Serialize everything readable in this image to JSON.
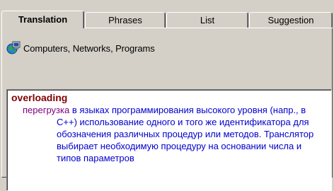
{
  "tabs": [
    {
      "label": "Translation",
      "active": true
    },
    {
      "label": "Phrases",
      "active": false
    },
    {
      "label": "List",
      "active": false
    },
    {
      "label": "Suggestion",
      "active": false
    }
  ],
  "category": {
    "icon": "globe-computer-icon",
    "label": "Computers, Networks, Programs"
  },
  "article": {
    "headword": "overloading",
    "translation": "перегрузка",
    "definition": "в языках программирования высокого уровня (напр., в С++) использование одного и того же идентификатора для обозначения различных процедур или методов. Транслятор выбирает необходимую процедуру на основании числа и типов параметров"
  },
  "colors": {
    "headword": "#800000",
    "translation": "#800080",
    "definition": "#0000cc",
    "background": "#d4d0c8"
  }
}
